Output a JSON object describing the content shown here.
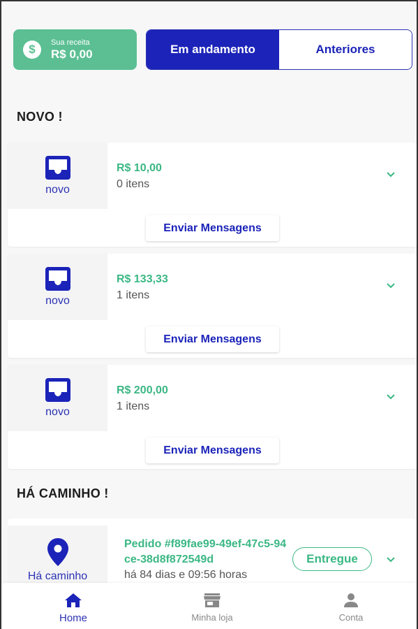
{
  "header": {
    "revenue_label": "Sua receita",
    "revenue_value": "R$ 0,00",
    "tabs": [
      {
        "label": "Em andamento",
        "active": true
      },
      {
        "label": "Anteriores",
        "active": false
      }
    ]
  },
  "sections": {
    "new_title": "NOVO !",
    "on_way_title": "HÁ CAMINHO !"
  },
  "new_orders": [
    {
      "status": "novo",
      "price": "R$ 10,00",
      "items": "0 itens",
      "button": "Enviar Mensagens"
    },
    {
      "status": "novo",
      "price": "R$ 133,33",
      "items": "1 itens",
      "button": "Enviar Mensagens"
    },
    {
      "status": "novo",
      "price": "R$ 200,00",
      "items": "1 itens",
      "button": "Enviar Mensagens"
    }
  ],
  "on_way_order": {
    "status": "Há caminho",
    "order_id": "Pedido #f89fae99-49ef-47c5-94ce-38d8f872549d",
    "elapsed": "há 84 dias e 09:56 horas",
    "button": "Entregue"
  },
  "bottom_nav": [
    {
      "label": "Home",
      "icon": "home-icon",
      "active": true
    },
    {
      "label": "Minha loja",
      "icon": "store-icon",
      "active": false
    },
    {
      "label": "Conta",
      "icon": "person-icon",
      "active": false
    }
  ],
  "colors": {
    "primary": "#1b23b8",
    "accent_green": "#3bb784",
    "revenue_bg": "#5bbf93"
  }
}
